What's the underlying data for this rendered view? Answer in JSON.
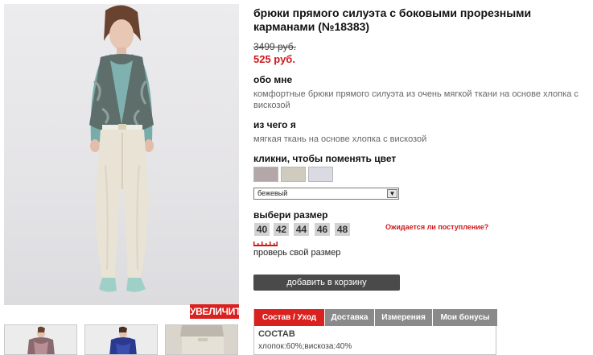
{
  "product": {
    "title": "брюки прямого силуэта с боковыми прорезными карманами (№18383)",
    "old_price": "3499 руб.",
    "new_price": "525 руб."
  },
  "gallery": {
    "zoom_label": "УВЕЛИЧИТЬ"
  },
  "about": {
    "heading": "обо мне",
    "text": "комфортные брюки прямого силуэта из очень мягкой ткани на основе хлопка с вискозой"
  },
  "material": {
    "heading": "из чего я",
    "text": "мягкая ткань на основе хлопка с вискозой"
  },
  "color": {
    "heading": "кликни, чтобы поменять цвет",
    "swatches": [
      "#b4a7a9",
      "#cfcbbe",
      "#dadbe2"
    ],
    "selected": "бежевый"
  },
  "size": {
    "heading": "выбери размер",
    "options": [
      "40",
      "42",
      "44",
      "46",
      "48"
    ],
    "awaiting": "Ожидается ли поступление?",
    "guide": "проверь свой размер"
  },
  "cart": {
    "label": "добавить в корзину"
  },
  "tabs": {
    "items": [
      "Состав / Уход",
      "Доставка",
      "Измерения",
      "Мои бонусы"
    ],
    "content_heading": "СОСТАВ",
    "content_text": "хлопок:60%;вискоза:40%"
  },
  "colors": {
    "accent": "#d9221f",
    "button_dark": "#4a4a4a",
    "tab_inactive": "#8a8a8a"
  }
}
